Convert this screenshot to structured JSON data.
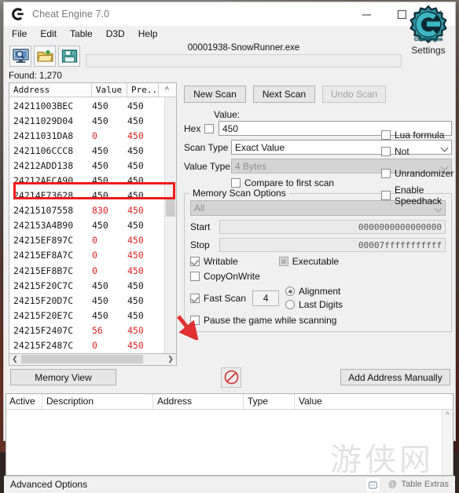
{
  "window": {
    "title": "Cheat Engine 7.0",
    "logo_icon": "cheat-engine-gear-e-icon",
    "minimize_icon": "minimize-icon",
    "maximize_icon": "maximize-icon",
    "close_icon": "close-icon"
  },
  "menubar": {
    "items": [
      "File",
      "Edit",
      "Table",
      "D3D",
      "Help"
    ]
  },
  "toolbar": {
    "buttons": [
      {
        "name": "open-process-button",
        "icon": "monitor-magnifier-icon"
      },
      {
        "name": "open-table-button",
        "icon": "open-folder-up-arrow-icon"
      },
      {
        "name": "save-table-button",
        "icon": "floppy-disk-save-icon"
      }
    ],
    "process_title": "00001938-SnowRunner.exe",
    "settings_label": "Settings",
    "settings_wordmark": "Cheat Engine"
  },
  "found": {
    "text": "Found: 1,270"
  },
  "scan_list": {
    "columns": [
      "Address",
      "Value",
      "Pre..",
      "^"
    ],
    "rows": [
      {
        "address": "24211003BEC",
        "value": "450",
        "previous": "450",
        "value_red": false,
        "previous_red": false,
        "selected": false
      },
      {
        "address": "24211029D04",
        "value": "450",
        "previous": "450",
        "value_red": false,
        "previous_red": false,
        "selected": false
      },
      {
        "address": "24211031DA8",
        "value": "0",
        "previous": "450",
        "value_red": true,
        "previous_red": true,
        "selected": false
      },
      {
        "address": "2421106CCC8",
        "value": "450",
        "previous": "450",
        "value_red": false,
        "previous_red": false,
        "selected": false
      },
      {
        "address": "24212ADD138",
        "value": "450",
        "previous": "450",
        "value_red": false,
        "previous_red": false,
        "selected": false
      },
      {
        "address": "24212AECA90",
        "value": "450",
        "previous": "450",
        "value_red": false,
        "previous_red": false,
        "selected": false
      },
      {
        "address": "24214F73628",
        "value": "450",
        "previous": "450",
        "value_red": false,
        "previous_red": false,
        "selected": false
      },
      {
        "address": "24215107558",
        "value": "830",
        "previous": "450",
        "value_red": true,
        "previous_red": true,
        "selected": true
      },
      {
        "address": "242153A4B90",
        "value": "450",
        "previous": "450",
        "value_red": false,
        "previous_red": false,
        "selected": false
      },
      {
        "address": "24215EF897C",
        "value": "0",
        "previous": "450",
        "value_red": true,
        "previous_red": true,
        "selected": false
      },
      {
        "address": "24215EF8A7C",
        "value": "0",
        "previous": "450",
        "value_red": true,
        "previous_red": true,
        "selected": false
      },
      {
        "address": "24215EF8B7C",
        "value": "0",
        "previous": "450",
        "value_red": true,
        "previous_red": true,
        "selected": false
      },
      {
        "address": "24215F20C7C",
        "value": "450",
        "previous": "450",
        "value_red": false,
        "previous_red": false,
        "selected": false
      },
      {
        "address": "24215F20D7C",
        "value": "450",
        "previous": "450",
        "value_red": false,
        "previous_red": false,
        "selected": false
      },
      {
        "address": "24215F20E7C",
        "value": "450",
        "previous": "450",
        "value_red": false,
        "previous_red": false,
        "selected": false
      },
      {
        "address": "24215F2407C",
        "value": "56",
        "previous": "450",
        "value_red": true,
        "previous_red": true,
        "selected": false
      },
      {
        "address": "24215F2487C",
        "value": "0",
        "previous": "450",
        "value_red": true,
        "previous_red": true,
        "selected": false
      }
    ],
    "hscroll_left_icon": "chevron-left-icon",
    "hscroll_right_icon": "chevron-right-icon"
  },
  "scan_panel": {
    "new_scan_label": "New Scan",
    "next_scan_label": "Next Scan",
    "undo_scan_label": "Undo Scan",
    "hex_label": "Hex",
    "hex_checked": false,
    "value_label": "Value:",
    "value_input": "450",
    "scan_type_label": "Scan Type",
    "scan_type_value": "Exact Value",
    "value_type_label": "Value Type",
    "value_type_value": "4 Bytes",
    "compare_first_label": "Compare to first scan",
    "compare_first_checked": false,
    "lua_formula_label": "Lua formula",
    "lua_formula_checked": false,
    "not_label": "Not",
    "not_checked": false,
    "unrandomizer_label": "Unrandomizer",
    "unrandomizer_checked": false,
    "speedhack_label": "Enable Speedhack",
    "speedhack_checked": false
  },
  "memory_scan_options": {
    "title": "Memory Scan Options",
    "region_value": "All",
    "start_label": "Start",
    "start_value": "0000000000000000",
    "stop_label": "Stop",
    "stop_value": "00007fffffffffff",
    "writable_label": "Writable",
    "writable_checked": true,
    "executable_label": "Executable",
    "executable_state": "grayed",
    "copyonwrite_label": "CopyOnWrite",
    "copyonwrite_checked": false,
    "fast_scan_label": "Fast Scan",
    "fast_scan_checked": true,
    "fast_scan_value": "4",
    "alignment_label": "Alignment",
    "alignment_selected": true,
    "last_digits_label": "Last Digits",
    "last_digits_selected": false,
    "pause_label": "Pause the game while scanning",
    "pause_checked": false
  },
  "midbar": {
    "memory_view_label": "Memory View",
    "no_icon": "no-entry-icon",
    "add_address_label": "Add Address Manually"
  },
  "cheat_table": {
    "columns": [
      "Active",
      "Description",
      "Address",
      "Type",
      "Value"
    ],
    "rows": [],
    "scroll_up_icon": "chevron-up-icon"
  },
  "statusbar": {
    "advanced_options_label": "Advanced Options",
    "table_extras_label": "Table Extras",
    "watermark_at": "@",
    "watermark_glyphs": "游侠网"
  },
  "annotations": {
    "highlight_box": {
      "target_row_address": "24215107558",
      "color": "#f11a1a"
    },
    "arrow": {
      "color": "#e03030",
      "direction": "down-right"
    }
  }
}
